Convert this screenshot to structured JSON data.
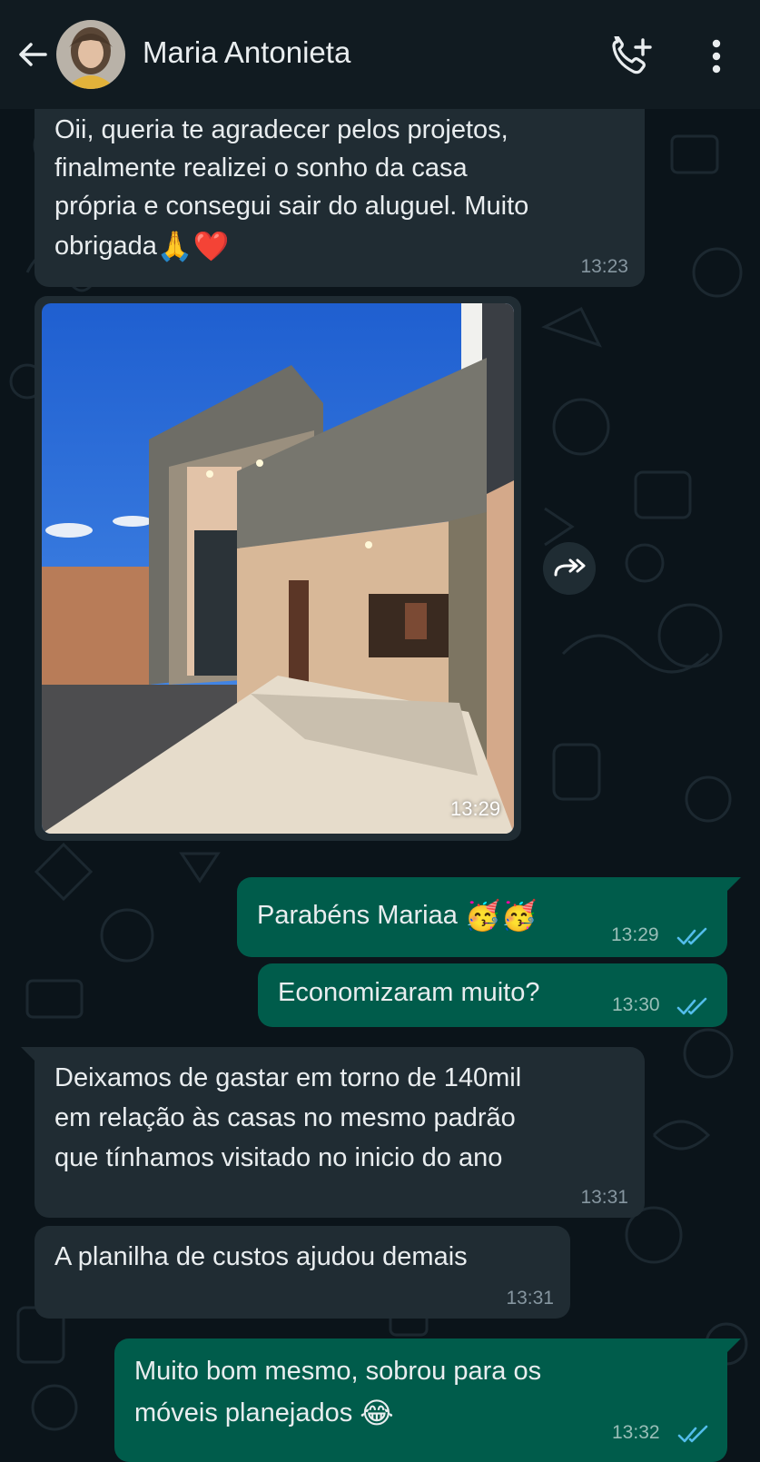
{
  "header": {
    "contact_name": "Maria Antonieta",
    "back_icon": "arrow-left-icon",
    "call_icon": "add-call-icon",
    "menu_icon": "more-vert-icon"
  },
  "colors": {
    "background": "#0b141a",
    "header": "#111b21",
    "incoming_bubble": "#202c33",
    "outgoing_bubble": "#005c4b",
    "read_ticks": "#53bdeb"
  },
  "messages": [
    {
      "direction": "incoming",
      "lines": [
        "Oii, queria te agradecer pelos projetos,",
        "finalmente realizei o sonho da casa",
        "própria e consegui sair do aluguel. Muito",
        "obrigada"
      ],
      "emoji": "🙏❤️",
      "time": "13:23"
    },
    {
      "direction": "incoming",
      "type": "image",
      "image_subject": "house-photo",
      "time": "13:29"
    },
    {
      "direction": "outgoing",
      "text": "Parabéns Mariaa",
      "emoji": "🥳🥳",
      "time": "13:29",
      "status": "read"
    },
    {
      "direction": "outgoing",
      "text": "Economizaram muito?",
      "time": "13:30",
      "status": "read"
    },
    {
      "direction": "incoming",
      "lines": [
        "Deixamos de gastar em torno de 140mil",
        "em relação às casas no mesmo padrão",
        "que tínhamos visitado no inicio do ano"
      ],
      "time": "13:31"
    },
    {
      "direction": "incoming",
      "text": "A planilha de custos ajudou demais",
      "time": "13:31"
    },
    {
      "direction": "outgoing",
      "lines": [
        "Muito bom mesmo, sobrou para os",
        "móveis planejados"
      ],
      "emoji": "😂",
      "time": "13:32",
      "status": "read"
    }
  ]
}
